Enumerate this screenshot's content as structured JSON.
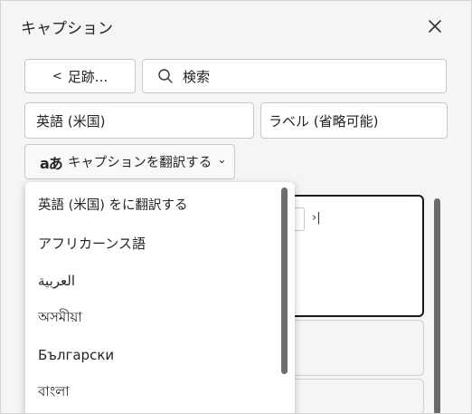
{
  "panel": {
    "title": "キャプション"
  },
  "toolbar": {
    "back_label": "足跡...",
    "back_chevron": "<",
    "search_placeholder": "検索"
  },
  "fields": {
    "language_value": "英語 (米国)",
    "label_placeholder": "ラベル (省略可能)"
  },
  "translate_button": {
    "label": "キャプションを翻訳する",
    "chevron": "⌄",
    "icon_glyph_a": "a",
    "icon_glyph_b": "あ"
  },
  "background": {
    "skip_to_end": "›|"
  },
  "dropdown": {
    "options": [
      "英語 (米国) をに翻訳する",
      "アフリカーンス語",
      "العربية",
      "অসমীয়া",
      "Български",
      "বাংলা"
    ]
  }
}
